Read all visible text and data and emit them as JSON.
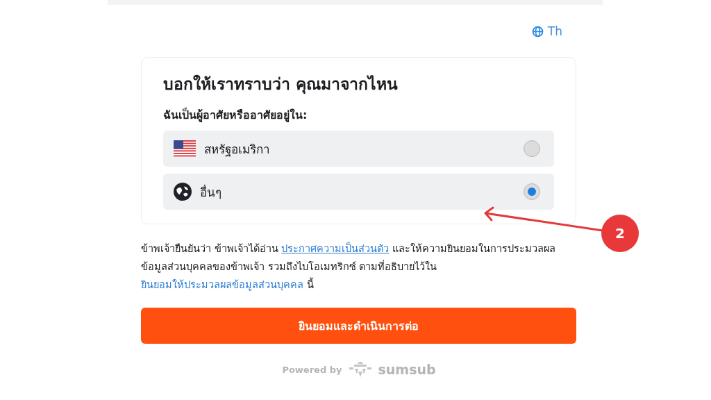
{
  "language": {
    "label": "Th"
  },
  "card": {
    "title": "บอกให้เราทราบว่า คุณมาจากไหน",
    "subtitle": "ฉันเป็นผู้อาศัยหรืออาศัยอยู่ใน:",
    "options": [
      {
        "kind": "us-flag",
        "label": "สหรัฐอเมริกา",
        "selected": false
      },
      {
        "kind": "globe",
        "label": "อื่นๆ",
        "selected": true
      }
    ]
  },
  "consent": [
    {
      "kind": "text",
      "text": "ข้าพเจ้ายืนยันว่า ข้าพเจ้าได้อ่าน "
    },
    {
      "kind": "link",
      "underline": true,
      "text": "ประกาศความเป็นส่วนตัว"
    },
    {
      "kind": "text",
      "text": " และให้ความยินยอมในการประมวลผลข้อมูลส่วนบุคคลของข้าพเจ้า รวมถึงไบโอเมทริกซ์ ตามที่อธิบายไว้ใน "
    },
    {
      "kind": "link",
      "underline": false,
      "text": "ยินยอมให้ประมวลผลข้อมูลส่วนบุคคล"
    },
    {
      "kind": "text",
      "text": " นี้"
    }
  ],
  "button": {
    "label": "ยินยอมและดำเนินการต่อ"
  },
  "footer": {
    "powered_by": "Powered by",
    "brand": "sumsub"
  },
  "annotation": {
    "label": "2"
  }
}
